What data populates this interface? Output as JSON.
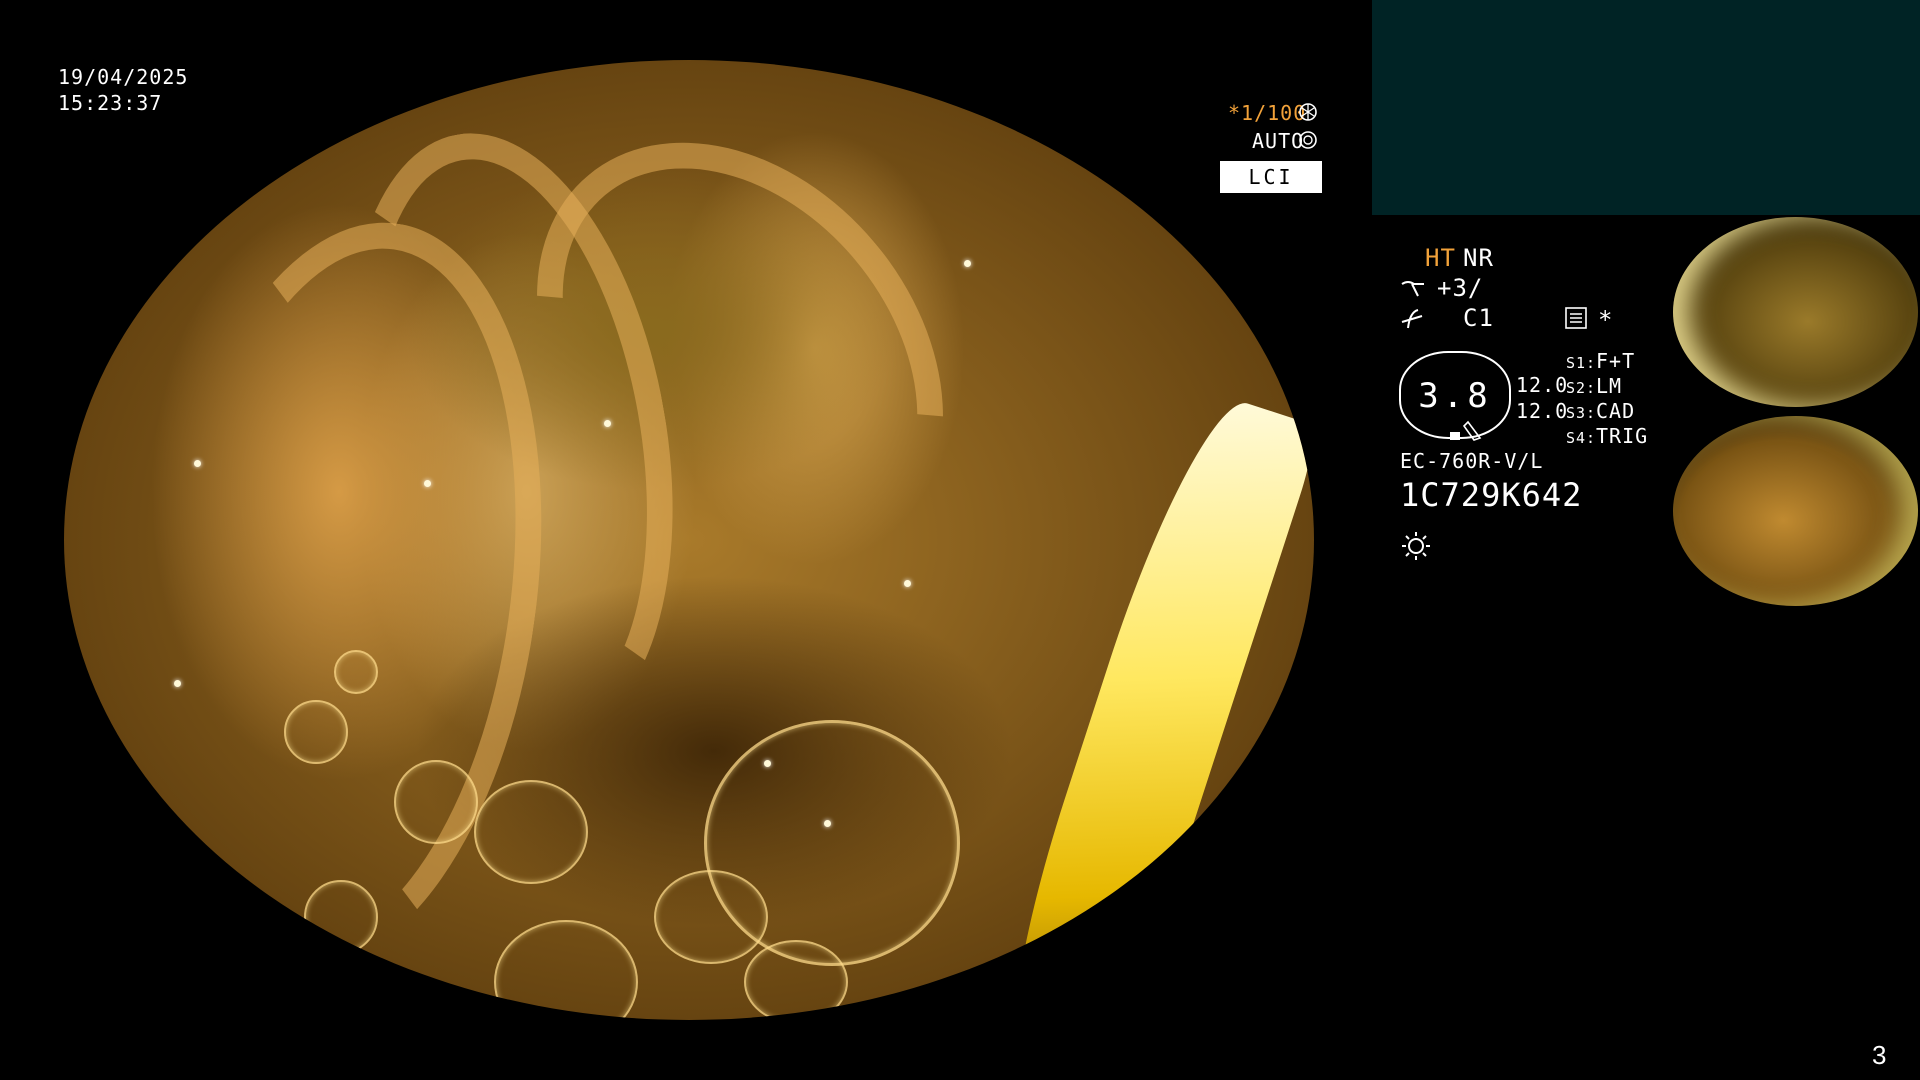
{
  "overlay": {
    "date": "19/04/2025",
    "time": "15:23:37",
    "shutter": "*1/100",
    "iris": "AUTO",
    "mode": "LCI",
    "ht": "HT",
    "nr": "NR",
    "enhance": "+3/",
    "color": "C1",
    "star": "*",
    "exposure_value": "3.8",
    "val_a": "12.0",
    "val_b": "12.0",
    "s1_key": "S1:",
    "s1_val": "F+T",
    "s2_key": "S2:",
    "s2_val": "LM",
    "s3_key": "S3:",
    "s3_val": "CAD",
    "s4_key": "S4:",
    "s4_val": "TRIG",
    "scope_model": "EC-760R-V/L",
    "serial": "1C729K642",
    "page_number": "3"
  },
  "colors": {
    "background": "#000000",
    "panel_teal": "#002325",
    "accent_orange": "#f2a23a"
  },
  "icons": [
    "shutter-icon",
    "iris-icon",
    "enhance-icon",
    "tone-icon",
    "memo-icon",
    "light-icon"
  ]
}
